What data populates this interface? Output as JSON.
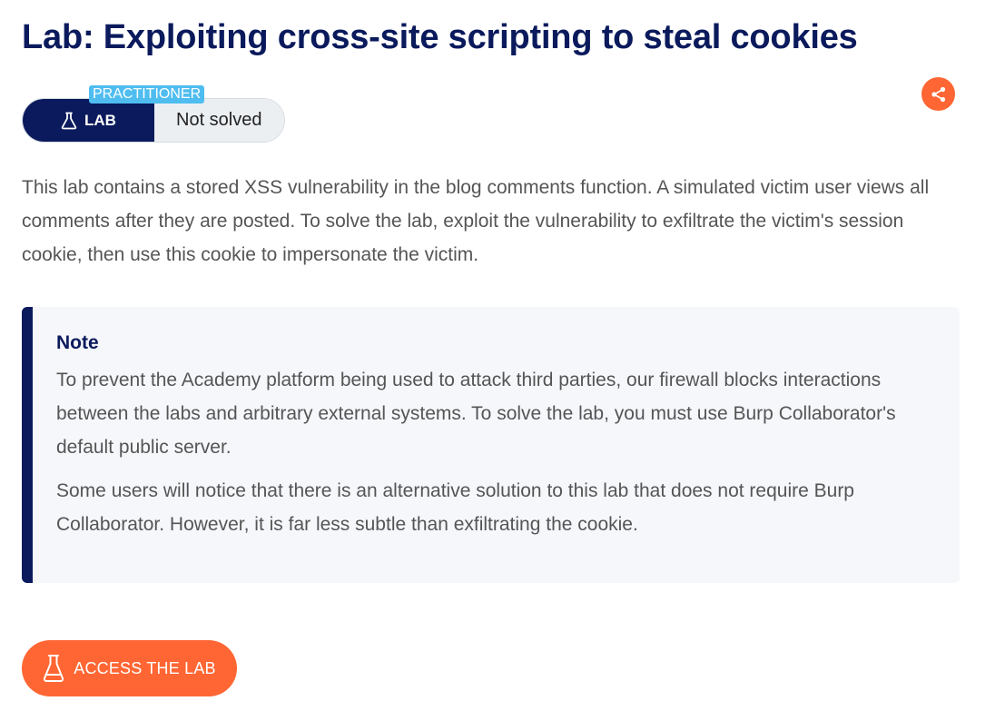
{
  "title": "Lab: Exploiting cross-site scripting to steal cookies",
  "badge": {
    "level": "PRACTITIONER",
    "type_label": "LAB",
    "type_icon": "flask-icon",
    "status": "Not solved"
  },
  "share": {
    "icon": "share-icon"
  },
  "description": "This lab contains a stored XSS vulnerability in the blog comments function. A simulated victim user views all comments after they are posted. To solve the lab, exploit the vulnerability to exfiltrate the victim's session cookie, then use this cookie to impersonate the victim.",
  "note": {
    "title": "Note",
    "paragraphs": [
      "To prevent the Academy platform being used to attack third parties, our firewall blocks interactions between the labs and arbitrary external systems. To solve the lab, you must use Burp Collaborator's default public server.",
      "Some users will notice that there is an alternative solution to this lab that does not require Burp Collaborator. However, it is far less subtle than exfiltrating the cookie."
    ]
  },
  "access_button": {
    "label": "ACCESS THE LAB",
    "icon": "flask-icon"
  },
  "colors": {
    "navy": "#0a1a5c",
    "orange": "#ff6633",
    "practitioner_blue": "#4fbdf0",
    "note_background": "#f5f7fb",
    "body_text": "#555555"
  }
}
